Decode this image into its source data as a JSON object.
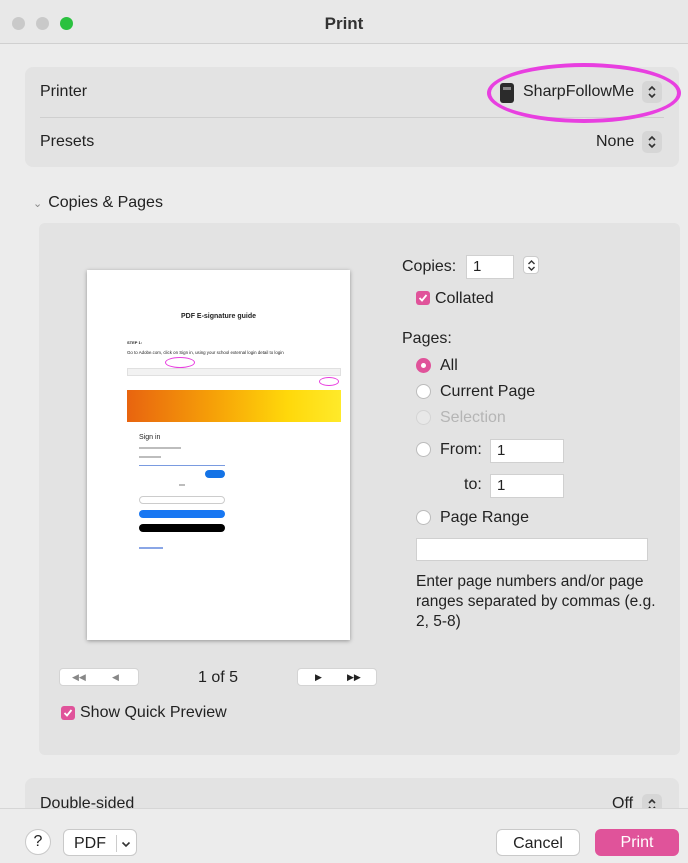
{
  "window": {
    "title": "Print"
  },
  "printer": {
    "label": "Printer",
    "value": "SharpFollowMe"
  },
  "presets": {
    "label": "Presets",
    "value": "None"
  },
  "section": {
    "title": "Copies & Pages"
  },
  "preview": {
    "doc_title": "PDF E-signature guide",
    "doc_step": "STEP 1:",
    "doc_line": "Go to Adobe.com, click on Sign in, using your school external login detail to login",
    "doc_signin": "Sign in",
    "page_indicator": "1 of 5",
    "show_quick_preview_label": "Show Quick Preview",
    "show_quick_preview_checked": true
  },
  "copies": {
    "label": "Copies:",
    "value": "1",
    "collated_label": "Collated",
    "collated_checked": true
  },
  "pages": {
    "label": "Pages:",
    "options": {
      "all": "All",
      "current": "Current Page",
      "selection": "Selection",
      "from": "From:",
      "range": "Page Range"
    },
    "selected": "all",
    "from_value": "1",
    "to_label": "to:",
    "to_value": "1",
    "range_value": "",
    "help_text": "Enter page numbers and/or page ranges separated by commas (e.g. 2, 5-8)"
  },
  "double_sided": {
    "label": "Double-sided",
    "value": "Off"
  },
  "footer": {
    "help_label": "?",
    "pdf_label": "PDF",
    "cancel_label": "Cancel",
    "print_label": "Print"
  },
  "colors": {
    "accent": "#e0539a",
    "highlight": "#e83fe0"
  },
  "icons": [
    "printer-icon",
    "chevron-updown-icon",
    "checkbox-check-icon",
    "first-page-icon",
    "prev-page-icon",
    "next-page-icon",
    "last-page-icon",
    "chevron-down-icon"
  ]
}
